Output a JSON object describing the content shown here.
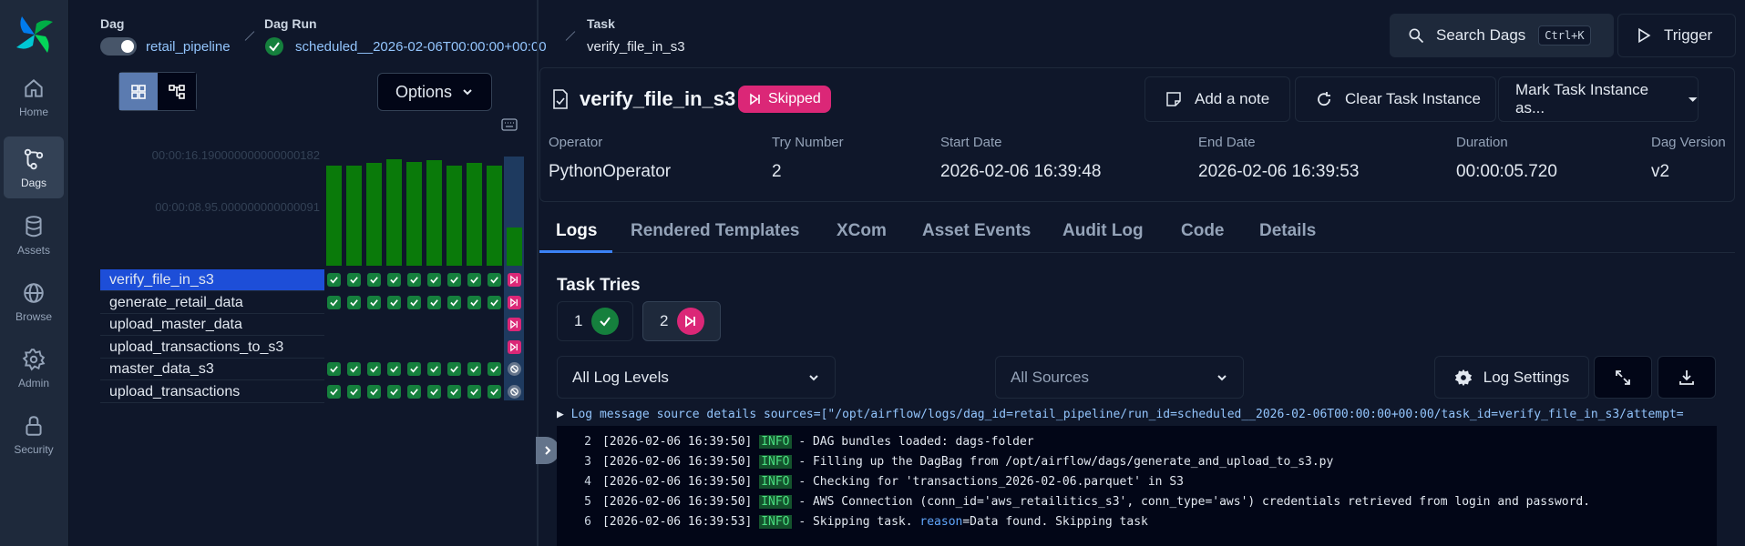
{
  "nav": {
    "items": [
      {
        "label": "Home",
        "icon": "home-icon"
      },
      {
        "label": "Dags",
        "icon": "dags-icon"
      },
      {
        "label": "Assets",
        "icon": "database-icon"
      },
      {
        "label": "Browse",
        "icon": "globe-icon"
      },
      {
        "label": "Admin",
        "icon": "gear-icon"
      },
      {
        "label": "Security",
        "icon": "lock-icon"
      }
    ]
  },
  "header": {
    "dag_label": "Dag",
    "dag_value": "retail_pipeline",
    "run_label": "Dag Run",
    "run_value": "scheduled__2026-02-06T00:00:00+00:00",
    "task_label": "Task",
    "task_value": "verify_file_in_s3",
    "search_label": "Search Dags",
    "search_kbd": "Ctrl+K",
    "trigger_label": "Trigger"
  },
  "grid": {
    "options_label": "Options",
    "axis_top": "00:00:16.190000000000000182",
    "axis_mid": "00:00:08.95.000000000000091",
    "bar_max_seconds": 16.19,
    "bar_durations": [
      14.8,
      14.9,
      15.2,
      15.8,
      15.4,
      15.6,
      14.9,
      15.3,
      14.8,
      5.72
    ],
    "tasks": [
      {
        "name": "verify_file_in_s3",
        "states": [
          "success",
          "success",
          "success",
          "success",
          "success",
          "success",
          "success",
          "success",
          "success",
          "skipped"
        ]
      },
      {
        "name": "generate_retail_data",
        "states": [
          "success",
          "success",
          "success",
          "success",
          "success",
          "success",
          "success",
          "success",
          "success",
          "skipped"
        ]
      },
      {
        "name": "upload_master_data",
        "states": [
          "",
          "",
          "",
          "",
          "",
          "",
          "",
          "",
          "",
          "skipped"
        ]
      },
      {
        "name": "upload_transactions_to_s3",
        "states": [
          "",
          "",
          "",
          "",
          "",
          "",
          "",
          "",
          "",
          "skipped"
        ]
      },
      {
        "name": "master_data_s3",
        "states": [
          "success",
          "success",
          "success",
          "success",
          "success",
          "success",
          "success",
          "success",
          "success",
          "none"
        ]
      },
      {
        "name": "upload_transactions",
        "states": [
          "success",
          "success",
          "success",
          "success",
          "success",
          "success",
          "success",
          "success",
          "success",
          "none"
        ]
      }
    ]
  },
  "detail": {
    "title": "verify_file_in_s3",
    "status": "Skipped",
    "add_note": "Add a note",
    "clear": "Clear Task Instance",
    "mark": "Mark Task Instance as...",
    "meta": [
      {
        "label": "Operator",
        "value": "PythonOperator"
      },
      {
        "label": "Try Number",
        "value": "2"
      },
      {
        "label": "Start Date",
        "value": "2026-02-06 16:39:48"
      },
      {
        "label": "End Date",
        "value": "2026-02-06 16:39:53"
      },
      {
        "label": "Duration",
        "value": "00:00:05.720"
      },
      {
        "label": "Dag Version",
        "value": "v2"
      }
    ]
  },
  "tabs": [
    "Logs",
    "Rendered Templates",
    "XCom",
    "Asset Events",
    "Audit Log",
    "Code",
    "Details"
  ],
  "tries": {
    "title": "Task Tries",
    "items": [
      {
        "n": "1",
        "state": "success"
      },
      {
        "n": "2",
        "state": "skipped"
      }
    ]
  },
  "logs": {
    "level_select": "All Log Levels",
    "source_select": "All Sources",
    "settings_label": "Log Settings",
    "source_details": "Log message source details sources=[\"/opt/airflow/logs/dag_id=retail_pipeline/run_id=scheduled__2026-02-06T00:00:00+00:00/task_id=verify_file_in_s3/attempt=",
    "lines": [
      {
        "n": "2",
        "ts": "[2026-02-06 16:39:50]",
        "level": "INFO",
        "msg": " - DAG bundles loaded: dags-folder"
      },
      {
        "n": "3",
        "ts": "[2026-02-06 16:39:50]",
        "level": "INFO",
        "msg": " - Filling up the DagBag from /opt/airflow/dags/generate_and_upload_to_s3.py"
      },
      {
        "n": "4",
        "ts": "[2026-02-06 16:39:50]",
        "level": "INFO",
        "msg": " - Checking for 'transactions_2026-02-06.parquet' in S3"
      },
      {
        "n": "5",
        "ts": "[2026-02-06 16:39:50]",
        "level": "INFO",
        "msg": " - AWS Connection (conn_id='aws_retailitics_s3', conn_type='aws') credentials retrieved from login and password."
      },
      {
        "n": "6",
        "ts": "[2026-02-06 16:39:53]",
        "level": "INFO",
        "msg": " - Skipping task. ",
        "reason_key": "reason",
        "reason_val": "=Data found. Skipping task"
      }
    ]
  }
}
